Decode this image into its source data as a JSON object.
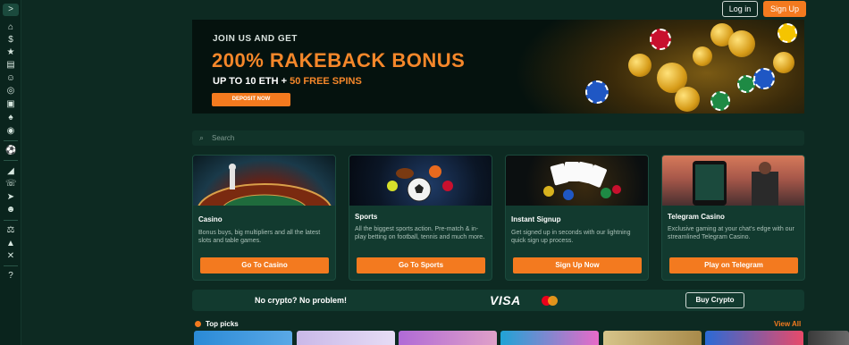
{
  "header": {
    "login_label": "Log in",
    "signup_label": "Sign Up"
  },
  "sidebar": {
    "toggle": ">",
    "icons": [
      "home-icon",
      "dollar-icon",
      "star-icon",
      "cards-icon",
      "users-icon",
      "casino-chip-icon",
      "slots-icon",
      "poker-icon",
      "roulette-icon",
      "soccer-ball-icon",
      "megaphone-icon",
      "support-icon",
      "telegram-icon",
      "community-icon",
      "lock-icon",
      "fairness-icon",
      "settings-icon",
      "help-icon"
    ]
  },
  "banner": {
    "kicker": "JOIN US AND GET",
    "title": "200% RAKEBACK BONUS",
    "sub_main": "UP TO 10 ETH + ",
    "sub_accent": "50 FREE SPINS",
    "cta": "DEPOSIT NOW"
  },
  "search": {
    "placeholder": "Search"
  },
  "cards": [
    {
      "title": "Casino",
      "desc": "Bonus buys, big multipliers and all the latest slots and table games.",
      "button": "Go To Casino"
    },
    {
      "title": "Sports",
      "desc": "All the biggest sports action. Pre-match & in-play betting on football, tennis and much more.",
      "button": "Go To Sports"
    },
    {
      "title": "Instant Signup",
      "desc": "Get signed up in seconds with our lightning quick sign up process.",
      "button": "Sign Up Now"
    },
    {
      "title": "Telegram Casino",
      "desc": "Exclusive gaming at your chat's edge with our streamlined Telegram Casino.",
      "button": "Play on Telegram"
    }
  ],
  "crypto": {
    "text": "No crypto? No problem!",
    "visa": "VISA",
    "button": "Buy Crypto"
  },
  "top_picks": {
    "title": "Top picks",
    "view_all": "View All"
  },
  "colors": {
    "accent": "#f37a1f",
    "background": "#0d2a22",
    "card": "#123a2f"
  }
}
